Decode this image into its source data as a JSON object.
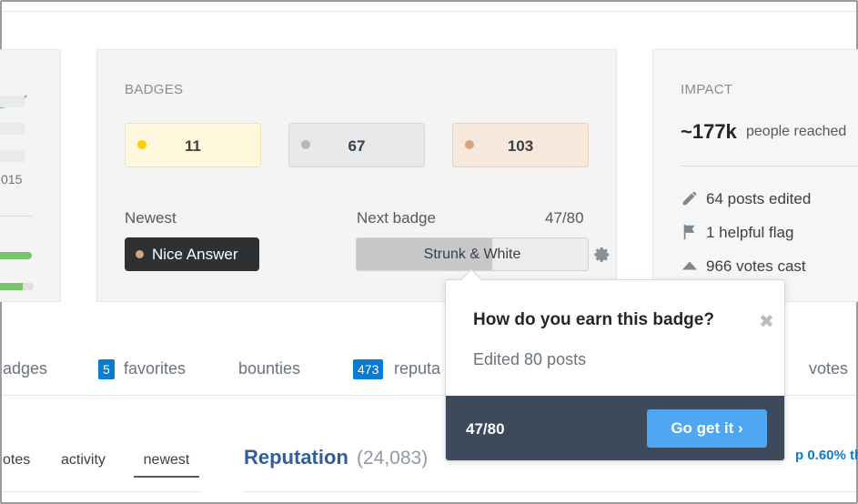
{
  "left_card": {
    "year_suffix": "015"
  },
  "badges_card": {
    "title": "BADGES",
    "gold_count": "11",
    "silver_count": "67",
    "bronze_count": "103",
    "newest_label": "Newest",
    "newest_badge": "Nice Answer",
    "next_badge_label": "Next badge",
    "next_badge_progress": "47/80",
    "next_badge_name": "Strunk & White",
    "next_badge_fraction": 0.5875
  },
  "impact_card": {
    "title": "IMPACT",
    "people_reached_value": "~177k",
    "people_reached_label": "people reached",
    "posts_edited": "64 posts edited",
    "helpful_flag": "1 helpful flag",
    "votes_cast": "966 votes cast"
  },
  "tabs": {
    "badges_partial": "adges",
    "favorites_count": "5",
    "favorites_label": "favorites",
    "bounties_label": "bounties",
    "reputation_count": "473",
    "reputation_partial": "reputa",
    "votes_label": "votes"
  },
  "bottom": {
    "votes_partial": "otes",
    "activity": "activity",
    "newest": "newest",
    "reputation_title": "Reputation",
    "reputation_total": "(24,083)",
    "top_percent_partial": "p 0.60% th"
  },
  "popover": {
    "title": "How do you earn this badge?",
    "close_glyph": "✖",
    "description": "Edited 80 posts",
    "progress": "47/80",
    "button_label": "Go get it ›"
  },
  "colors": {
    "gold": "#ffcc01",
    "silver": "#b4b8bc",
    "bronze": "#d1a684",
    "link_blue": "#0a7bd3",
    "popover_footer": "#3c4a5b",
    "cta_blue": "#4ea7f0"
  }
}
